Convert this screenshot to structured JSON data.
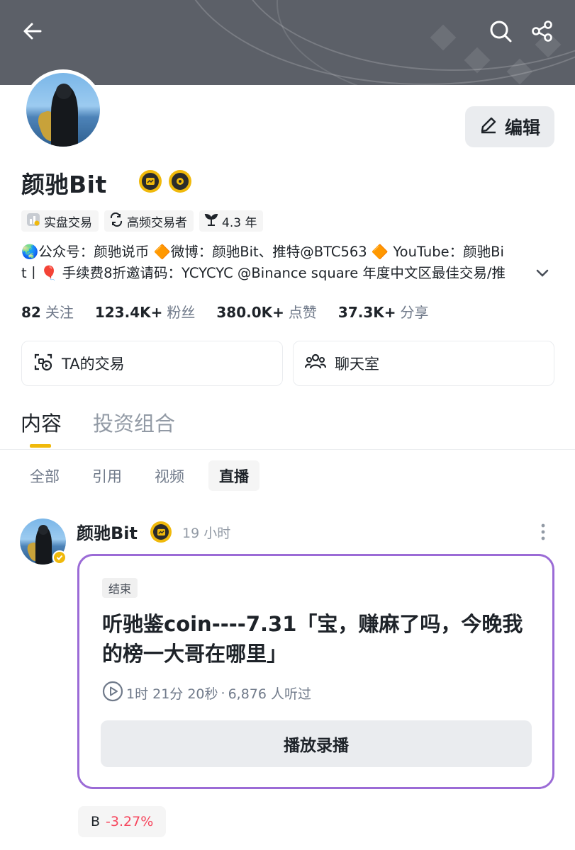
{
  "profile": {
    "name": "颜驰Bit",
    "edit_label": "编辑",
    "tags": [
      {
        "label": "实盘交易",
        "icon": "chart-icon"
      },
      {
        "label": "高频交易者",
        "icon": "repeat-icon"
      },
      {
        "label": "4.3 年",
        "icon": "sprout-icon"
      }
    ],
    "bio_line1": "🌏公众号：颜驰说币 🔶微博：颜驰Bit、推特@BTC563 🔶 YouTube：颜驰Bi",
    "bio_line2": "t丨🎈 手续费8折邀请码：YCYCYC @Binance square 年度中文区最佳交易/推"
  },
  "stats": [
    {
      "value": "82",
      "label": "关注"
    },
    {
      "value": "123.4K+",
      "label": "粉丝"
    },
    {
      "value": "380.0K+",
      "label": "点赞"
    },
    {
      "value": "37.3K+",
      "label": "分享"
    }
  ],
  "actions": {
    "trades_label": "TA的交易",
    "chat_label": "聊天室"
  },
  "tabs": {
    "main": [
      "内容",
      "投资组合"
    ],
    "main_active": 0,
    "sub": [
      "全部",
      "引用",
      "视频",
      "直播"
    ],
    "sub_active": 3
  },
  "post": {
    "author": "颜驰Bit",
    "time": "19 小时",
    "status": "结束",
    "title": "听驰鉴coin----7.31「宝，赚麻了吗，今晚我的榜一大哥在哪里」",
    "duration": "1时 21分 20秒",
    "separator": "·",
    "listeners": "6,876 人听过",
    "replay_label": "播放录播"
  },
  "ticker": {
    "symbol": "B",
    "change": "-3.27%"
  },
  "colors": {
    "accent": "#f0b90b",
    "live_border": "#9b6bd6",
    "negative": "#f6465d",
    "banner": "#5c6068"
  }
}
